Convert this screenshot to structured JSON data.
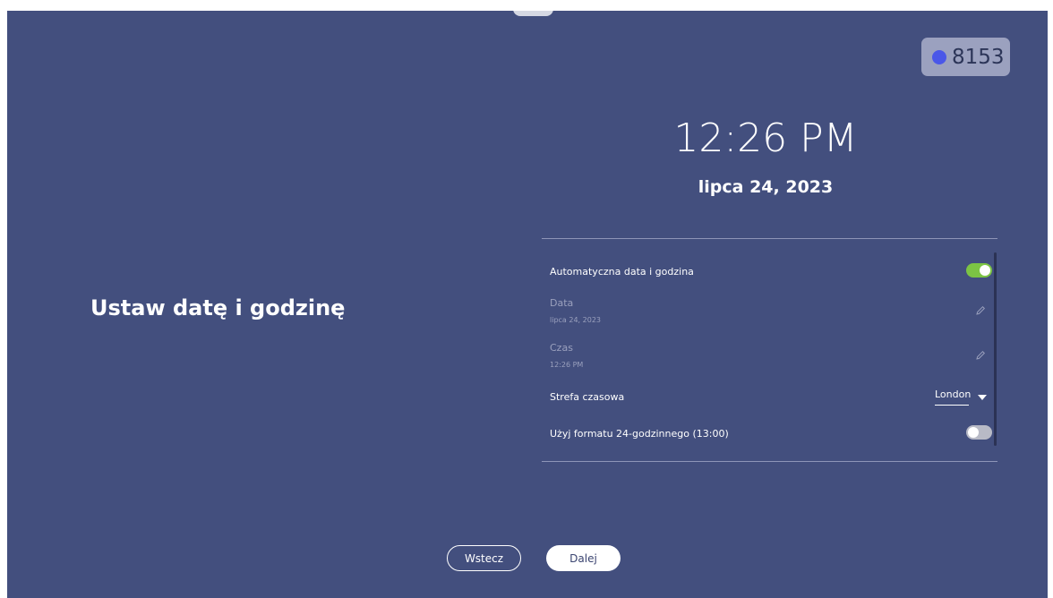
{
  "device_badge": {
    "number": "8153",
    "dot_color": "#4a57e8"
  },
  "page_title": "Ustaw datę i godzinę",
  "clock": {
    "time": "12:26 PM",
    "date": "lipca 24, 2023"
  },
  "settings": {
    "auto_datetime": {
      "label": "Automatyczna data i godzina",
      "enabled": true
    },
    "date": {
      "label": "Data",
      "value": "lipca 24, 2023"
    },
    "time": {
      "label": "Czas",
      "value": "12:26 PM"
    },
    "timezone": {
      "label": "Strefa czasowa",
      "value": "London"
    },
    "format_24h": {
      "label": "Użyj formatu 24-godzinnego (13:00)",
      "enabled": false
    }
  },
  "buttons": {
    "back": "Wstecz",
    "next": "Dalej"
  },
  "colors": {
    "background": "#434f7e",
    "toggle_on": "#7cc444",
    "toggle_off": "#b8bac6"
  }
}
